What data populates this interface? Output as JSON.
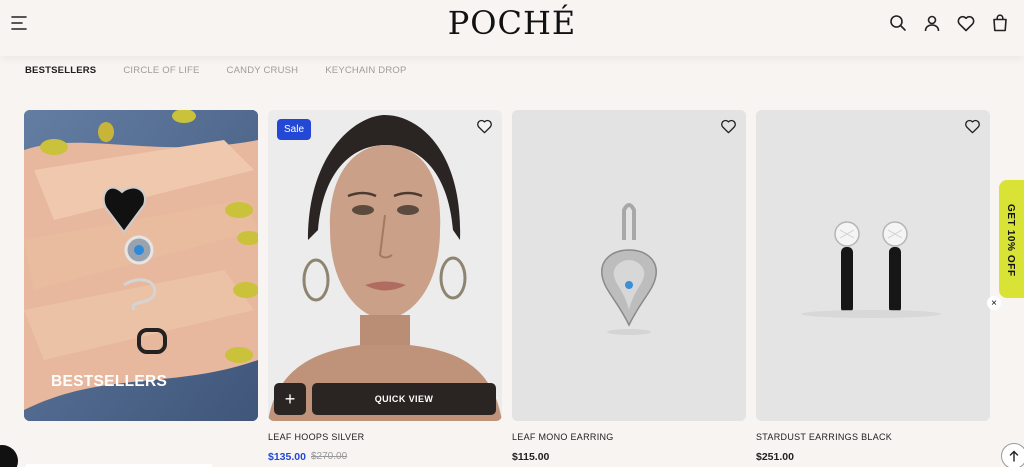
{
  "header": {
    "logo": "POCHÉ",
    "icons": [
      "menu-icon",
      "search-icon",
      "account-icon",
      "heart-icon",
      "bag-icon"
    ]
  },
  "tabs": [
    {
      "label": "BESTSELLERS",
      "active": true
    },
    {
      "label": "CIRCLE OF LIFE",
      "active": false
    },
    {
      "label": "CANDY CRUSH",
      "active": false
    },
    {
      "label": "KEYCHAIN DROP",
      "active": false
    }
  ],
  "promo": {
    "label": "BESTSELLERS"
  },
  "products": [
    {
      "badge": "Sale",
      "name": "LEAF HOOPS SILVER",
      "price": "$135.00",
      "old_price": "$270.00",
      "add_label": "+",
      "quick_view": "QUICK VIEW"
    },
    {
      "name": "LEAF MONO EARRING",
      "price": "$115.00"
    },
    {
      "name": "STARDUST EARRINGS BLACK",
      "price": "$251.00"
    }
  ],
  "side_offer": {
    "label": "GET 10% OFF",
    "close": "×"
  },
  "colors": {
    "accent": "#2448d6",
    "offer": "#d8e336",
    "dark_button": "#2a2522",
    "background": "#f7f4f2"
  }
}
